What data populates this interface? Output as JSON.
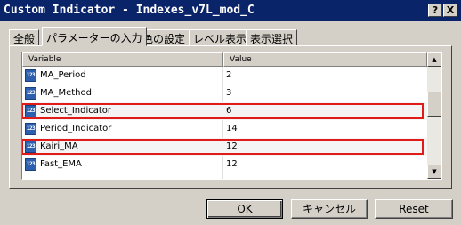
{
  "window": {
    "title": "Custom Indicator - Indexes_v7L_mod_C",
    "help_label": "?",
    "close_label": "X"
  },
  "tabs": [
    {
      "label": "全般"
    },
    {
      "label": "パラメーターの入力"
    },
    {
      "label": "色の設定"
    },
    {
      "label": "レベル表示"
    },
    {
      "label": "表示選択"
    }
  ],
  "active_tab": "パラメーターの入力",
  "table": {
    "columns": [
      "Variable",
      "Value"
    ],
    "icon_text": "123",
    "rows": [
      {
        "name": "MA_Period",
        "value": "2",
        "highlighted": false
      },
      {
        "name": "MA_Method",
        "value": "3",
        "highlighted": false
      },
      {
        "name": "Select_Indicator",
        "value": "6",
        "highlighted": true
      },
      {
        "name": "Period_Indicator",
        "value": "14",
        "highlighted": false
      },
      {
        "name": "Kairi_MA",
        "value": "12",
        "highlighted": true
      },
      {
        "name": "Fast_EMA",
        "value": "12",
        "highlighted": false
      }
    ]
  },
  "colors": {
    "titlebar": "#0a246a",
    "highlight_border": "#e11a1a",
    "dialog_face": "#d4d0c8"
  },
  "buttons": {
    "ok": "OK",
    "cancel": "キャンセル",
    "reset": "Reset"
  }
}
